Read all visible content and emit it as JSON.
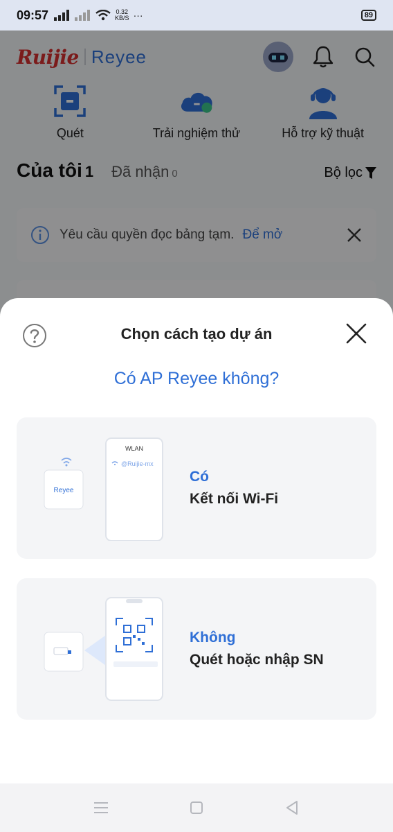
{
  "status_bar": {
    "time": "09:57",
    "speed": "0.32",
    "speed_unit": "KB/S",
    "more": "···",
    "battery": "89"
  },
  "header": {
    "brand_primary": "Ruijie",
    "brand_secondary": "Reyee"
  },
  "shortcuts": [
    {
      "label": "Quét",
      "icon": "scan-icon"
    },
    {
      "label": "Trải nghiệm thử",
      "icon": "cloud-icon"
    },
    {
      "label": "Hỗ trợ kỹ thuật",
      "icon": "support-agent-icon"
    }
  ],
  "tabs": {
    "mine_label": "Của tôi",
    "mine_count": "1",
    "received_label": "Đã nhận",
    "received_count": "0",
    "filter_label": "Bộ lọc"
  },
  "notice": {
    "text": "Yêu cầu quyền đọc bảng tạm.",
    "link": "Để mở"
  },
  "sheet": {
    "title": "Chọn cách tạo dự án",
    "question": "Có AP Reyee không?",
    "options": [
      {
        "title": "Có",
        "subtitle": "Kết nối Wi-Fi",
        "phone_header": "WLAN",
        "ssid": "@Ruijie-mx",
        "device_label": "Reyee"
      },
      {
        "title": "Không",
        "subtitle": "Quét hoặc nhập SN"
      }
    ]
  },
  "colors": {
    "accent": "#2f6fd6",
    "brand_red": "#d42f2f",
    "sheet_bg": "#ffffff",
    "card_bg": "#f4f5f7"
  }
}
